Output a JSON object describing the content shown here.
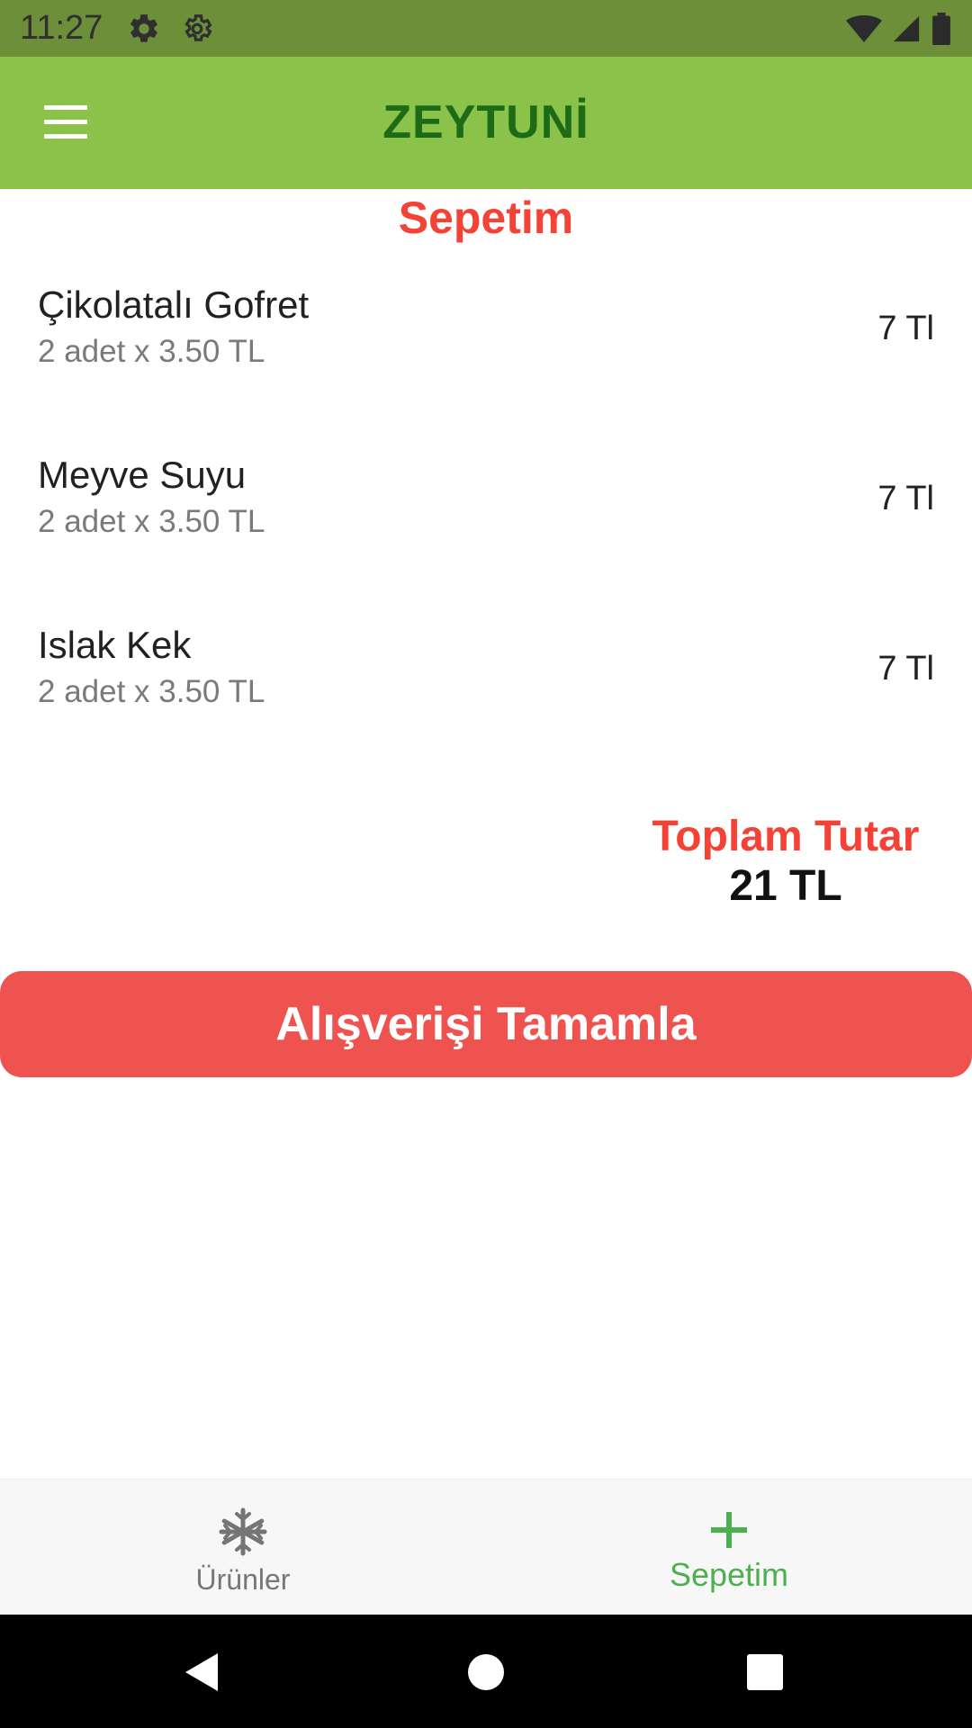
{
  "status_bar": {
    "time": "11:27",
    "icons": [
      "settings-icon",
      "settings-outline-icon",
      "wifi-icon",
      "signal-icon",
      "battery-icon"
    ]
  },
  "app_bar": {
    "menu_icon": "menu-icon",
    "title": "ZEYTUNİ"
  },
  "cart": {
    "title": "Sepetim",
    "items": [
      {
        "name": "Çikolatalı Gofret",
        "detail": "2 adet x 3.50 TL",
        "total": "7 Tl"
      },
      {
        "name": "Meyve Suyu",
        "detail": "2 adet x 3.50 TL",
        "total": "7 Tl"
      },
      {
        "name": "Islak Kek",
        "detail": "2 adet x 3.50 TL",
        "total": "7 Tl"
      }
    ],
    "total_label": "Toplam Tutar",
    "total_value": "21 TL",
    "checkout_label": "Alışverişi Tamamla"
  },
  "bottom_nav": {
    "items": [
      {
        "label": "Ürünler",
        "icon": "snowflake-icon",
        "active": false
      },
      {
        "label": "Sepetim",
        "icon": "plus-icon",
        "active": true
      }
    ]
  },
  "system_nav": {
    "icons": [
      "back-icon",
      "home-icon",
      "recents-icon"
    ]
  },
  "colors": {
    "status_bar": "#6e8f3a",
    "app_bar": "#8bc34a",
    "title_green": "#1e6b17",
    "accent_red": "#f44336",
    "button_red": "#ef5350",
    "active_green": "#4caf50"
  }
}
